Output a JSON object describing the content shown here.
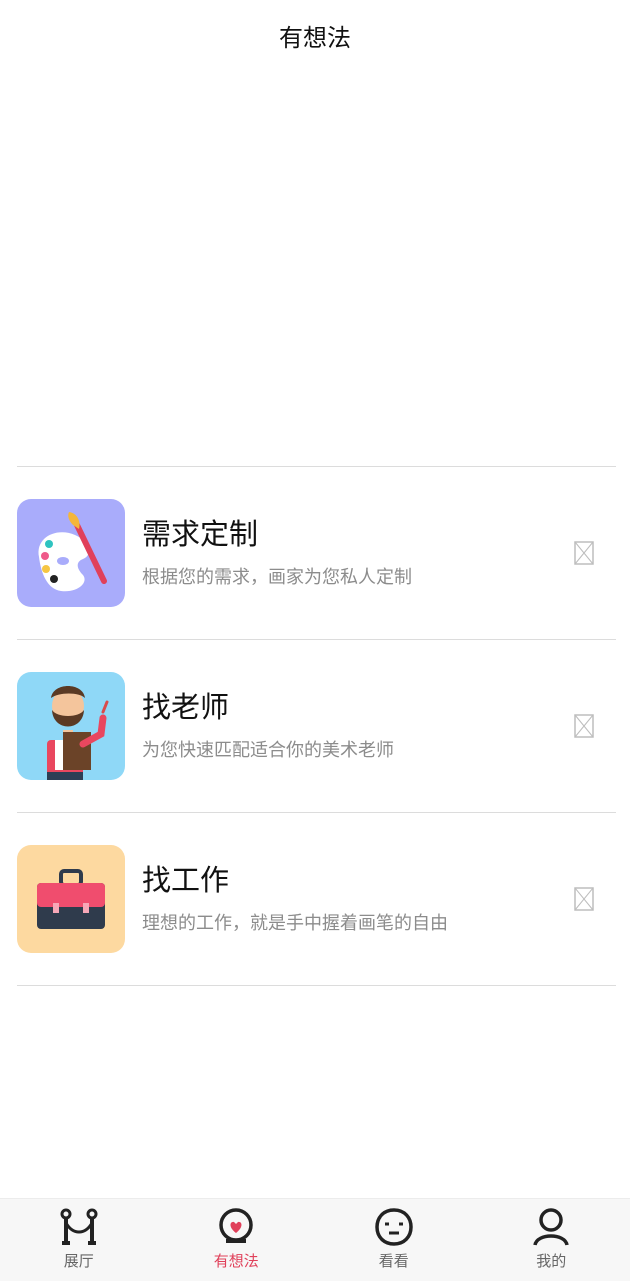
{
  "header": {
    "title": "有想法"
  },
  "items": [
    {
      "title": "需求定制",
      "subtitle": "根据您的需求，画家为您私人定制",
      "icon": "palette-icon",
      "bg": "#a9acfb"
    },
    {
      "title": "找老师",
      "subtitle": "为您快速匹配适合你的美术老师",
      "icon": "teacher-icon",
      "bg": "#8fd8f7"
    },
    {
      "title": "找工作",
      "subtitle": "理想的工作，就是手中握着画笔的自由",
      "icon": "briefcase-icon",
      "bg": "#fdd9a0"
    }
  ],
  "tabs": [
    {
      "label": "展厅",
      "icon": "gallery-icon",
      "active": false
    },
    {
      "label": "有想法",
      "icon": "idea-icon",
      "active": true
    },
    {
      "label": "看看",
      "icon": "face-icon",
      "active": false
    },
    {
      "label": "我的",
      "icon": "user-icon",
      "active": false
    }
  ],
  "colors": {
    "accent": "#e0405a",
    "divider": "#dcdcdc",
    "subtitle": "#8c8c8c"
  }
}
